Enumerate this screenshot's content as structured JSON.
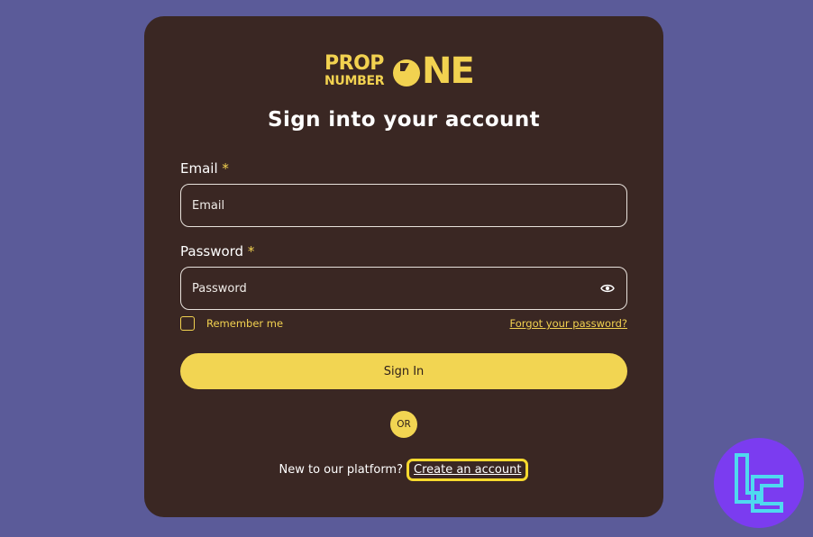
{
  "brand": {
    "logo_line1": "PROP",
    "logo_line2": "NUMBER",
    "logo_big": "NE",
    "accent_color": "#f2d250"
  },
  "form": {
    "title": "Sign into your account",
    "email": {
      "label": "Email",
      "required_mark": "*",
      "placeholder": "Email",
      "value": ""
    },
    "password": {
      "label": "Password",
      "required_mark": "*",
      "placeholder": "Password",
      "value": "",
      "toggle_icon": "eye-icon"
    },
    "remember_label": "Remember me",
    "remember_checked": false,
    "forgot_link": "Forgot your password?",
    "submit_label": "Sign In",
    "divider": "OR",
    "signup_prompt": "New to our platform?",
    "signup_link": "Create an account"
  },
  "colors": {
    "page_bg": "#5b5b99",
    "card_bg": "#3a2723",
    "button_bg": "#f2d552",
    "badge_bg": "#7b3cf0"
  },
  "watermark_icon": "tc-logo-icon"
}
